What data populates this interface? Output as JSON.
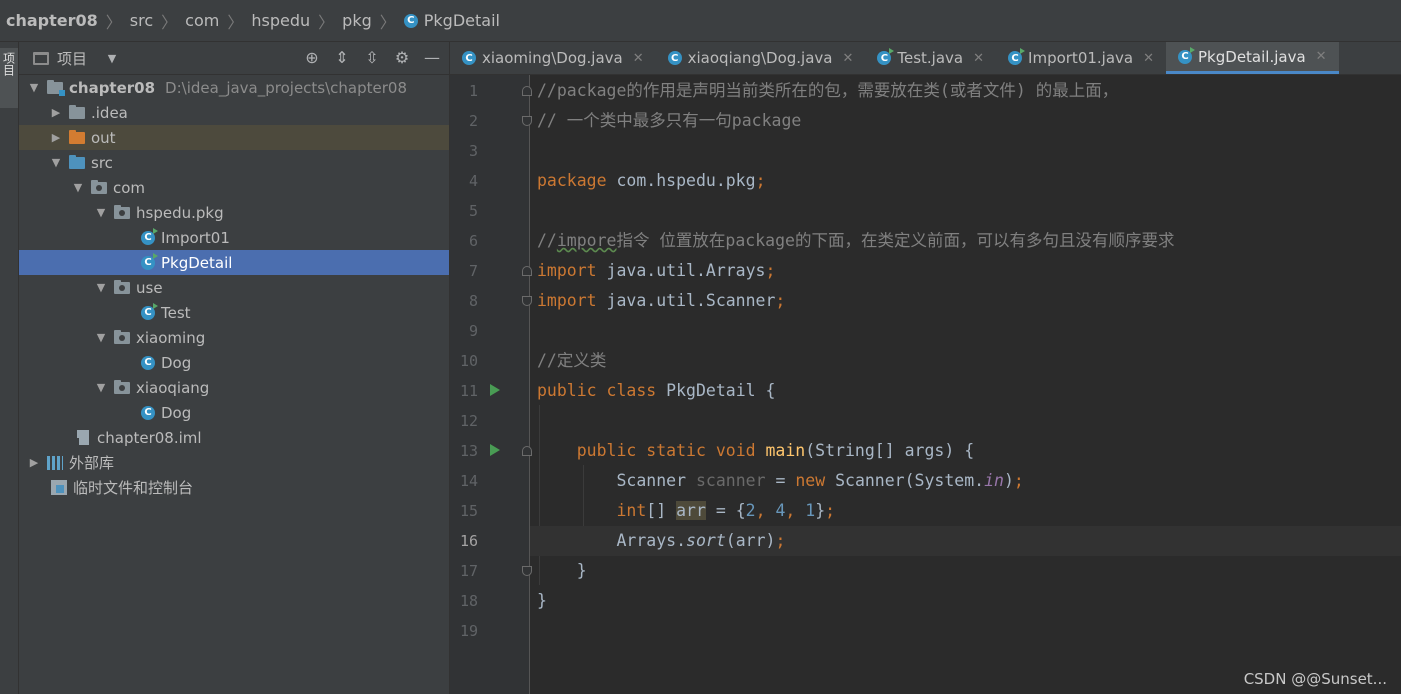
{
  "breadcrumb": {
    "items": [
      "chapter08",
      "src",
      "com",
      "hspedu",
      "pkg",
      "PkgDetail"
    ]
  },
  "left_stripe": {
    "label": "项目"
  },
  "project_panel": {
    "title": "项目",
    "tree": [
      {
        "label": "chapter08",
        "hint": "D:\\idea_java_projects\\chapter08"
      },
      {
        "label": ".idea"
      },
      {
        "label": "out"
      },
      {
        "label": "src"
      },
      {
        "label": "com"
      },
      {
        "label": "hspedu.pkg"
      },
      {
        "label": "Import01"
      },
      {
        "label": "PkgDetail"
      },
      {
        "label": "use"
      },
      {
        "label": "Test"
      },
      {
        "label": "xiaoming"
      },
      {
        "label": "Dog"
      },
      {
        "label": "xiaoqiang"
      },
      {
        "label": "Dog"
      },
      {
        "label": "chapter08.iml"
      },
      {
        "label": "外部库"
      },
      {
        "label": "临时文件和控制台"
      }
    ]
  },
  "tabs": [
    {
      "label": "xiaoming\\Dog.java"
    },
    {
      "label": "xiaoqiang\\Dog.java"
    },
    {
      "label": "Test.java"
    },
    {
      "label": "Import01.java"
    },
    {
      "label": "PkgDetail.java"
    }
  ],
  "editor": {
    "line_numbers": [
      "1",
      "2",
      "3",
      "4",
      "5",
      "6",
      "7",
      "8",
      "9",
      "10",
      "11",
      "12",
      "13",
      "14",
      "15",
      "16",
      "17",
      "18",
      "19"
    ],
    "current_line": "16",
    "code": {
      "l1": "//package的作用是声明当前类所在的包，需要放在类(或者文件) 的最上面，",
      "l2": "// 一个类中最多只有一句package",
      "l4_kw": "package",
      "l4_rest": " com.hspedu.pkg",
      "l4_semi": ";",
      "l6_a": "//",
      "l6_b": "impore",
      "l6_c": "指令 位置放在package的下面，在类定义前面，可以有多句且没有顺序要求",
      "l7_kw": "import",
      "l7_rest": " java.util.Arrays",
      "l8_kw": "import",
      "l8_rest": " java.util.Scanner",
      "l10": "//定义类",
      "l11_kw": "public class",
      "l11_rest": " PkgDetail {",
      "l13_kw": "public static void",
      "l13_fn": "main",
      "l13_rest": "(String[] args) {",
      "l14_a": "Scanner ",
      "l14_var": "scanner",
      "l14_b": " = ",
      "l14_new": "new",
      "l14_c": " Scanner(System.",
      "l14_in": "in",
      "l14_d": ")",
      "l15_kw": "int",
      "l15_a": "[] ",
      "l15_var": "arr",
      "l15_b": " = {",
      "l15_n1": "2",
      "l15_n2": "4",
      "l15_n3": "1",
      "l15_c": "}",
      "l16_a": "Arrays.",
      "l16_sort": "sort",
      "l16_b": "(arr)",
      "l17": "}",
      "l18": "}",
      "semi": ";",
      "comma": ", "
    }
  },
  "watermark": "CSDN @@Sunset...",
  "colors": {
    "background": "#2b2b2b",
    "panel": "#3c3f41",
    "selection": "#4b6eaf",
    "keyword": "#cc7832",
    "comment": "#808080",
    "number": "#6897bb",
    "function": "#ffc66d",
    "static_field": "#9876aa"
  },
  "icons": [
    "java-class-icon",
    "folder-icon",
    "run-gutter-icon",
    "fold-icon",
    "gear-icon",
    "collapse-all-icon",
    "expand-all-icon",
    "locate-icon",
    "minimize-icon"
  ]
}
